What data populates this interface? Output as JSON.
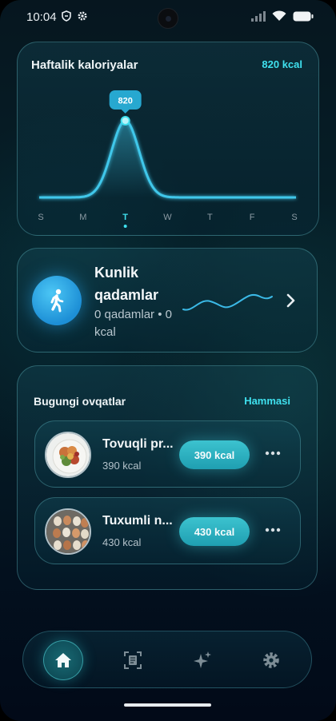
{
  "status_bar": {
    "time": "10:04"
  },
  "calories_card": {
    "title": "Haftalik kaloriyalar",
    "total": "820 kcal",
    "chart_data": {
      "type": "area",
      "title": "",
      "categories": [
        "S",
        "M",
        "T",
        "W",
        "T",
        "F",
        "S"
      ],
      "series": [
        {
          "values": [
            0,
            0,
            820,
            0,
            0,
            0,
            0
          ]
        }
      ],
      "highlight_index": 2,
      "tooltip": "820",
      "grid": false,
      "colors": {
        "line": "#3fc7ea",
        "highlight": "#3fe0ee"
      }
    }
  },
  "steps_card": {
    "title": "Kunlik qadamlar",
    "subtitle": "0 qadamlar • 0 kcal",
    "icon": "walking-person-icon"
  },
  "meals_card": {
    "title": "Bugungi ovqatlar",
    "see_all": "Hammasi",
    "items": [
      {
        "name": "Tovuqli pr...",
        "kcal": "390 kcal",
        "badge": "390 kcal"
      },
      {
        "name": "Tuxumli n...",
        "kcal": "430 kcal",
        "badge": "430 kcal"
      }
    ]
  },
  "bottom_nav": {
    "items": [
      {
        "icon": "home-icon",
        "active": true
      },
      {
        "icon": "scan-document-icon",
        "active": false
      },
      {
        "icon": "sparkles-icon",
        "active": false
      },
      {
        "icon": "gear-icon",
        "active": false
      }
    ]
  },
  "colors": {
    "accent": "#3fe0ee",
    "badge": "#2fb3c3"
  }
}
